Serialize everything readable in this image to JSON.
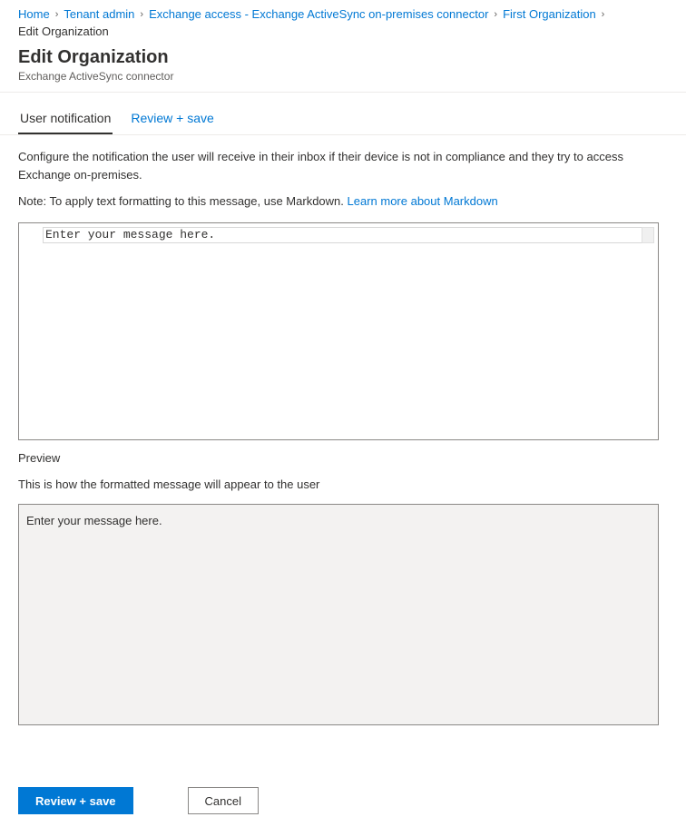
{
  "breadcrumb": {
    "items": [
      {
        "label": "Home",
        "link": true
      },
      {
        "label": "Tenant admin",
        "link": true
      },
      {
        "label": "Exchange access - Exchange ActiveSync on-premises connector",
        "link": true
      },
      {
        "label": "First Organization",
        "link": true
      },
      {
        "label": "Edit Organization",
        "link": false
      }
    ]
  },
  "header": {
    "title": "Edit Organization",
    "subtitle": "Exchange ActiveSync connector"
  },
  "tabs": [
    {
      "label": "User notification",
      "active": true
    },
    {
      "label": "Review + save",
      "active": false
    }
  ],
  "content": {
    "description": "Configure the notification the user will receive in their inbox if their device is not in compliance and they try to access Exchange on-premises.",
    "note_prefix": "Note: To apply text formatting to this message, use Markdown. ",
    "note_link": "Learn more about Markdown",
    "textarea_placeholder": "Enter your message here.",
    "preview_label": "Preview",
    "preview_subtext": "This is how the formatted message will appear to the user",
    "preview_content": "Enter your message here."
  },
  "footer": {
    "primary_label": "Review + save",
    "secondary_label": "Cancel"
  }
}
